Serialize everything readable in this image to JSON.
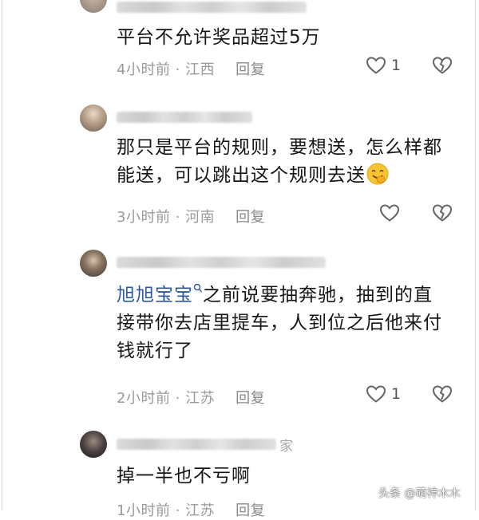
{
  "comments": [
    {
      "text_lines": [
        "平台不允许奖品超过5万"
      ],
      "time": "4小时前",
      "location": "江西",
      "reply_label": "回复",
      "like_count": "1"
    },
    {
      "text_lines": [
        "那只是平台的规则，要想送，怎么样都",
        "能送，可以跳出这个规则去送"
      ],
      "time": "3小时前",
      "location": "河南",
      "reply_label": "回复",
      "like_count": ""
    },
    {
      "mention": "旭旭宝宝",
      "text_lines": [
        "之前说要抽奔驰，抽到的直",
        "接带你去店里提车，人到位之后他来付",
        "钱就行了"
      ],
      "time": "2小时前",
      "location": "江苏",
      "reply_label": "回复",
      "like_count": "1"
    },
    {
      "name_suffix": "家",
      "text_lines": [
        "掉一半也不亏啊"
      ],
      "time": "1小时前",
      "location": "江苏",
      "reply_label": "回复",
      "like_count": ""
    }
  ],
  "separator": " · ",
  "watermark": "头条 @萌神木木",
  "icons": {
    "like": "heart-outline-icon",
    "dislike": "broken-heart-icon",
    "mention": "search-link-icon",
    "emoji": "smiling-face-emoji"
  },
  "colors": {
    "mention": "#2f5a9e",
    "meta": "#9a9a9a"
  }
}
